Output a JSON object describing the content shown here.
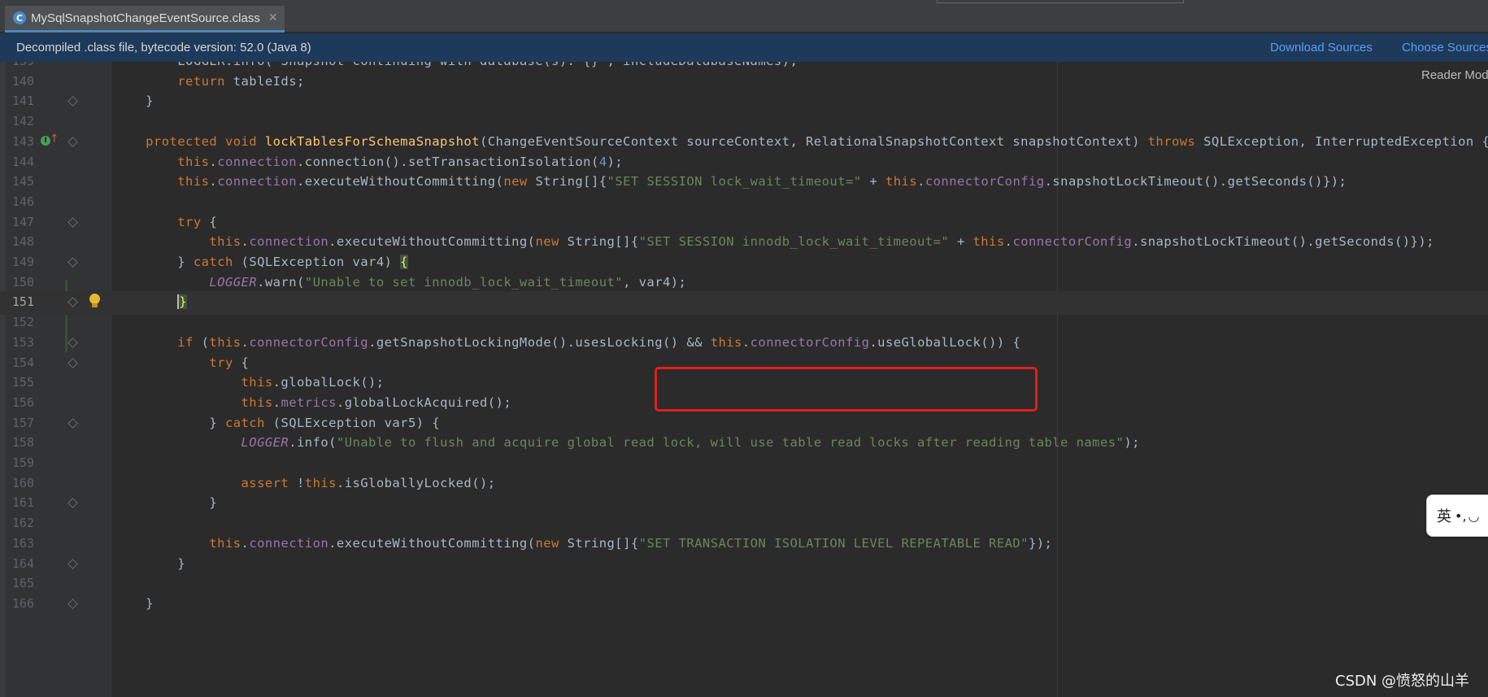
{
  "tab": {
    "title": "MySqlSnapshotChangeEventSource.class",
    "icon": "decompiled-class-icon",
    "icon_glyph": "C",
    "close_glyph": "✕"
  },
  "banner": {
    "text": "Decompiled .class file, bytecode version: 52.0 (Java 8)",
    "download_sources": "Download Sources",
    "choose_sources": "Choose Sources..."
  },
  "reader_mode": "Reader Mode",
  "ime": {
    "lang": "英",
    "punct": "•,",
    "moon": "◡"
  },
  "watermark": "CSDN @愤怒的山羊",
  "colors": {
    "background": "#2b2b2b",
    "keyword": "#cc7832",
    "field": "#9876aa",
    "string": "#6a8759",
    "number": "#6897bb",
    "method_decl": "#ffc66d",
    "highlight_box": "#e0201c",
    "link": "#589df6"
  },
  "lines": [
    {
      "n": "139",
      "tokens": [
        [
          "t",
          "        LOGGER.info(\"Snapshot continuing with database(s): {}\", includeDatabaseNames);"
        ]
      ]
    },
    {
      "n": "140",
      "tokens": [
        [
          "k",
          "        return"
        ],
        [
          "t",
          " tableIds;"
        ]
      ]
    },
    {
      "n": "141",
      "tokens": [
        [
          "t",
          "    }"
        ]
      ]
    },
    {
      "n": "142",
      "tokens": []
    },
    {
      "n": "143",
      "tokens": [
        [
          "k",
          "    protected void "
        ],
        [
          "m",
          "lockTablesForSchemaSnapshot"
        ],
        [
          "t",
          "(ChangeEventSourceContext sourceContext, RelationalSnapshotContext snapshotContext) "
        ],
        [
          "k",
          "throws "
        ],
        [
          "t",
          "SQLException, InterruptedException {"
        ]
      ]
    },
    {
      "n": "144",
      "tokens": [
        [
          "k",
          "        this"
        ],
        [
          "t",
          "."
        ],
        [
          "f",
          "connection"
        ],
        [
          "t",
          ".connection().setTransactionIsolation("
        ],
        [
          "n",
          "4"
        ],
        [
          "t",
          ");"
        ]
      ]
    },
    {
      "n": "145",
      "tokens": [
        [
          "k",
          "        this"
        ],
        [
          "t",
          "."
        ],
        [
          "f",
          "connection"
        ],
        [
          "t",
          ".executeWithoutCommitting("
        ],
        [
          "k",
          "new "
        ],
        [
          "t",
          "String[]{"
        ],
        [
          "s",
          "\"SET SESSION lock_wait_timeout=\""
        ],
        [
          "t",
          " + "
        ],
        [
          "k",
          "this"
        ],
        [
          "t",
          "."
        ],
        [
          "f",
          "connectorConfig"
        ],
        [
          "t",
          ".snapshotLockTimeout().getSeconds()});"
        ]
      ]
    },
    {
      "n": "146",
      "tokens": []
    },
    {
      "n": "147",
      "tokens": [
        [
          "k",
          "        try "
        ],
        [
          "t",
          "{"
        ]
      ]
    },
    {
      "n": "148",
      "tokens": [
        [
          "k",
          "            this"
        ],
        [
          "t",
          "."
        ],
        [
          "f",
          "connection"
        ],
        [
          "t",
          ".executeWithoutCommitting("
        ],
        [
          "k",
          "new "
        ],
        [
          "t",
          "String[]{"
        ],
        [
          "s",
          "\"SET SESSION innodb_lock_wait_timeout=\""
        ],
        [
          "t",
          " + "
        ],
        [
          "k",
          "this"
        ],
        [
          "t",
          "."
        ],
        [
          "f",
          "connectorConfig"
        ],
        [
          "t",
          ".snapshotLockTimeout().getSeconds()});"
        ]
      ]
    },
    {
      "n": "149",
      "tokens": [
        [
          "t",
          "        } "
        ],
        [
          "k",
          "catch "
        ],
        [
          "t",
          "(SQLException var4) "
        ],
        [
          "b",
          "{"
        ]
      ]
    },
    {
      "n": "150",
      "tokens": [
        [
          "i",
          "            LOGGER"
        ],
        [
          "t",
          ".warn("
        ],
        [
          "s",
          "\"Unable to set innodb_lock_wait_timeout\""
        ],
        [
          "t",
          ", var4);"
        ]
      ]
    },
    {
      "n": "151",
      "tokens": [
        [
          "t",
          "        "
        ],
        [
          "c",
          "}"
        ]
      ]
    },
    {
      "n": "152",
      "tokens": []
    },
    {
      "n": "153",
      "tokens": [
        [
          "k",
          "        if "
        ],
        [
          "t",
          "("
        ],
        [
          "k",
          "this"
        ],
        [
          "t",
          "."
        ],
        [
          "f",
          "connectorConfig"
        ],
        [
          "t",
          ".getSnapshotLockingMode().usesLocking() && "
        ],
        [
          "k",
          "this"
        ],
        [
          "t",
          "."
        ],
        [
          "f",
          "connectorConfig"
        ],
        [
          "t",
          ".useGlobalLock()) {"
        ]
      ]
    },
    {
      "n": "154",
      "tokens": [
        [
          "k",
          "            try "
        ],
        [
          "t",
          "{"
        ]
      ]
    },
    {
      "n": "155",
      "tokens": [
        [
          "k",
          "                this"
        ],
        [
          "t",
          ".globalLock();"
        ]
      ]
    },
    {
      "n": "156",
      "tokens": [
        [
          "k",
          "                this"
        ],
        [
          "t",
          "."
        ],
        [
          "f",
          "metrics"
        ],
        [
          "t",
          ".globalLockAcquired();"
        ]
      ]
    },
    {
      "n": "157",
      "tokens": [
        [
          "t",
          "            } "
        ],
        [
          "k",
          "catch "
        ],
        [
          "t",
          "(SQLException var5) {"
        ]
      ]
    },
    {
      "n": "158",
      "tokens": [
        [
          "i",
          "                LOGGER"
        ],
        [
          "t",
          ".info("
        ],
        [
          "s",
          "\"Unable to flush and acquire global read lock, will use table read locks after reading table names\""
        ],
        [
          "t",
          ");"
        ]
      ]
    },
    {
      "n": "159",
      "tokens": []
    },
    {
      "n": "160",
      "tokens": [
        [
          "k",
          "                assert "
        ],
        [
          "t",
          "!"
        ],
        [
          "k",
          "this"
        ],
        [
          "t",
          ".isGloballyLocked();"
        ]
      ]
    },
    {
      "n": "161",
      "tokens": [
        [
          "t",
          "            }"
        ]
      ]
    },
    {
      "n": "162",
      "tokens": []
    },
    {
      "n": "163",
      "tokens": [
        [
          "k",
          "            this"
        ],
        [
          "t",
          "."
        ],
        [
          "f",
          "connection"
        ],
        [
          "t",
          ".executeWithoutCommitting("
        ],
        [
          "k",
          "new "
        ],
        [
          "t",
          "String[]{"
        ],
        [
          "s",
          "\"SET TRANSACTION ISOLATION LEVEL REPEATABLE READ\""
        ],
        [
          "t",
          "});"
        ]
      ]
    },
    {
      "n": "164",
      "tokens": [
        [
          "t",
          "        }"
        ]
      ]
    },
    {
      "n": "165",
      "tokens": []
    },
    {
      "n": "166",
      "tokens": [
        [
          "t",
          "    }"
        ]
      ]
    }
  ]
}
